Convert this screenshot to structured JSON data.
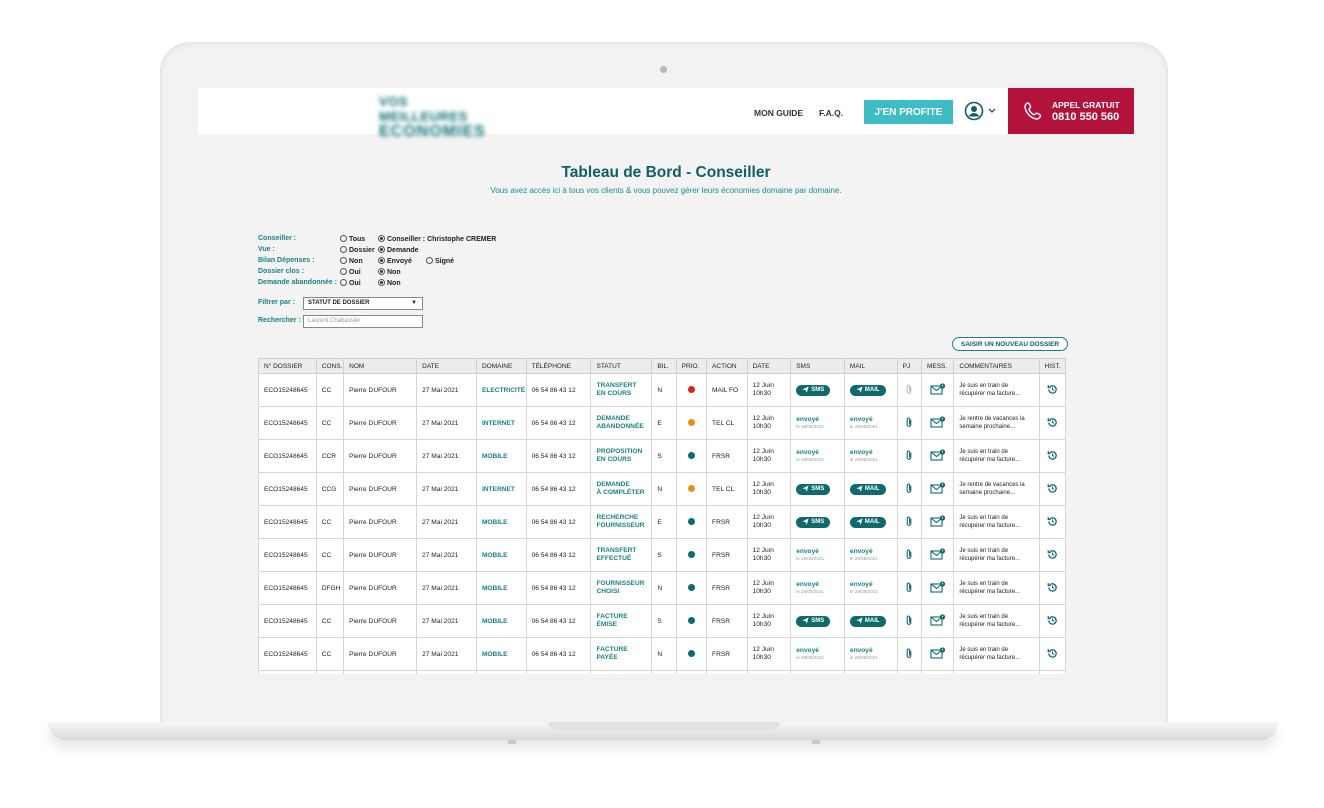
{
  "header": {
    "logo_line1": "VOS MEILLEURES",
    "logo_line2": "ECONOMIES",
    "nav": [
      "MON GUIDE",
      "F.A.Q."
    ],
    "cta_label": "J'EN PROFITE",
    "call_label": "APPEL GRATUIT",
    "call_number": "0810 550 560"
  },
  "page": {
    "title": "Tableau de Bord - Conseiller",
    "subtitle": "Vous avez accès ici à tous vos clients & vous pouvez gérer leurs économies domaine par domaine."
  },
  "filters": [
    {
      "label": "Conseiller :",
      "options": [
        {
          "text": "Tous",
          "selected": false
        },
        {
          "text": "Conseiller : Christophe CREMER",
          "selected": true
        }
      ]
    },
    {
      "label": "Vue :",
      "options": [
        {
          "text": "Dossier",
          "selected": false
        },
        {
          "text": "Demande",
          "selected": true
        }
      ]
    },
    {
      "label": "Bilan Dépenses :",
      "options": [
        {
          "text": "Non",
          "selected": false
        },
        {
          "text": "Envoyé",
          "selected": true
        },
        {
          "text": "Signé",
          "selected": false
        }
      ]
    },
    {
      "label": "Dossier clos :",
      "options": [
        {
          "text": "Oui",
          "selected": false
        },
        {
          "text": "Non",
          "selected": true
        }
      ]
    },
    {
      "label": "Demande abandonnée :",
      "options": [
        {
          "text": "Oui",
          "selected": false
        },
        {
          "text": "Non",
          "selected": true
        }
      ]
    }
  ],
  "filter_by": {
    "label": "Filtrer par :",
    "value": "STATUT DE DOSSIER"
  },
  "search": {
    "label": "Rechercher :",
    "placeholder": "Laurent Chabassier"
  },
  "new_button": "SAISIR UN NOUVEAU DOSSIER",
  "table": {
    "columns": [
      "N° DOSSIER",
      "CONS.",
      "NOM",
      "DATE",
      "DOMAINE",
      "TÉLÉPHONE",
      "STATUT",
      "BIL.",
      "PRIO.",
      "ACTION",
      "DATE",
      "SMS",
      "MAIL",
      "PJ",
      "MESS.",
      "COMMENTAIRES",
      "HIST."
    ],
    "sms_label": "SMS",
    "mail_label": "MAIL",
    "sent_label": "envoyé",
    "rows": [
      {
        "num": "ECO15248645",
        "cons": "CC",
        "nom": "Pierre DUFOUR",
        "date": "27 Mai 2021",
        "domaine": "ELECTRICITÉ",
        "tel": "06 54 86 43 12",
        "statut": [
          "TRANSFERT",
          "EN COURS"
        ],
        "bil": "N",
        "prio": "#e0201c",
        "action": "MAIL FO",
        "date2": [
          "12 Juin",
          "10h30"
        ],
        "sms": {
          "type": "button"
        },
        "mail": {
          "type": "button"
        },
        "pj": "inactive",
        "comment": [
          "Je suis en train de",
          "récupérer ma facture..."
        ]
      },
      {
        "num": "ECO15248645",
        "cons": "CC",
        "nom": "Pierre DUFOUR",
        "date": "27 Mai 2021",
        "domaine": "INTERNET",
        "tel": "06 54 86 43 12",
        "statut": [
          "DEMANDE",
          "ABANDONNÉE"
        ],
        "bil": "E",
        "prio": "#e8901a",
        "action": "TEL CL",
        "date2": [
          "12 Juin",
          "10h30"
        ],
        "sms": {
          "type": "sent",
          "date": "le 28/05/2021"
        },
        "mail": {
          "type": "sent",
          "date": "le 28/05/2021"
        },
        "pj": "active",
        "comment": [
          "Je rentre de vacances la",
          "semaine prochaine..."
        ]
      },
      {
        "num": "ECO15248645",
        "cons": "CCR",
        "nom": "Pierre DUFOUR",
        "date": "27 Mai 2021",
        "domaine": "MOBILE",
        "tel": "06 54 86 43 12",
        "statut": [
          "PROPOSITION",
          "EN COURS"
        ],
        "bil": "S",
        "prio": "#0f6a6e",
        "action": "FRSR",
        "date2": [
          "12 Juin",
          "10h30"
        ],
        "sms": {
          "type": "sent",
          "date": "le 28/05/2021"
        },
        "mail": {
          "type": "sent",
          "date": "le 28/05/2021"
        },
        "pj": "active",
        "comment": [
          "Je suis en train de",
          "récupérer ma facture..."
        ]
      },
      {
        "num": "ECO15248645",
        "cons": "CCG",
        "nom": "Pierre DUFOUR",
        "date": "27 Mai 2021",
        "domaine": "INTERNET",
        "tel": "06 54 86 43 12",
        "statut": [
          "DEMANDE",
          "À COMPLÉTER"
        ],
        "bil": "N",
        "prio": "#e8901a",
        "action": "TEL CL",
        "date2": [
          "12 Juin",
          "10h30"
        ],
        "sms": {
          "type": "button"
        },
        "mail": {
          "type": "button"
        },
        "pj": "active",
        "comment": [
          "Je rentre de vacances la",
          "semaine prochaine..."
        ]
      },
      {
        "num": "ECO15248645",
        "cons": "CC",
        "nom": "Pierre DUFOUR",
        "date": "27 Mai 2021",
        "domaine": "MOBILE",
        "tel": "06 54 86 43 12",
        "statut": [
          "RECHERCHE",
          "FOURNISSEUR"
        ],
        "bil": "E",
        "prio": "#0f6a6e",
        "action": "FRSR",
        "date2": [
          "12 Juin",
          "10h30"
        ],
        "sms": {
          "type": "button"
        },
        "mail": {
          "type": "button"
        },
        "pj": "active",
        "comment": [
          "Je suis en train de",
          "récupérer ma facture..."
        ]
      },
      {
        "num": "ECO15248645",
        "cons": "CC",
        "nom": "Pierre DUFOUR",
        "date": "27 Mai 2021",
        "domaine": "MOBILE",
        "tel": "06 54 86 43 12",
        "statut": [
          "TRANSFERT",
          "EFFECTUÉ"
        ],
        "bil": "S",
        "prio": "#0f6a6e",
        "action": "FRSR",
        "date2": [
          "12 Juin",
          "10h30"
        ],
        "sms": {
          "type": "sent",
          "date": "le 28/05/2021"
        },
        "mail": {
          "type": "sent",
          "date": "le 28/05/2021"
        },
        "pj": "active",
        "comment": [
          "Je suis en train de",
          "récupérer ma facture..."
        ]
      },
      {
        "num": "ECO15248645",
        "cons": "DFGH",
        "nom": "Pierre DUFOUR",
        "date": "27 Mai 2021",
        "domaine": "MOBILE",
        "tel": "06 54 86 43 12",
        "statut": [
          "FOURNISSEUR",
          "CHOISI"
        ],
        "bil": "N",
        "prio": "#0f6a6e",
        "action": "FRSR",
        "date2": [
          "12 Juin",
          "10h30"
        ],
        "sms": {
          "type": "sent",
          "date": "le 28/05/2021"
        },
        "mail": {
          "type": "sent",
          "date": "le 28/05/2021"
        },
        "pj": "active",
        "comment": [
          "Je suis en train de",
          "récupérer ma facture..."
        ]
      },
      {
        "num": "ECO15248645",
        "cons": "CC",
        "nom": "Pierre DUFOUR",
        "date": "27 Mai 2021",
        "domaine": "MOBILE",
        "tel": "06 54 86 43 12",
        "statut": [
          "FACTURE",
          "ÉMISE"
        ],
        "bil": "S",
        "prio": "#0f6a6e",
        "action": "FRSR",
        "date2": [
          "12 Juin",
          "10h30"
        ],
        "sms": {
          "type": "button"
        },
        "mail": {
          "type": "button"
        },
        "pj": "active",
        "comment": [
          "Je suis en train de",
          "récupérer ma facture..."
        ]
      },
      {
        "num": "ECO15248645",
        "cons": "CC",
        "nom": "Pierre DUFOUR",
        "date": "27 Mai 2021",
        "domaine": "MOBILE",
        "tel": "06 54 86 43 12",
        "statut": [
          "FACTURE",
          "PAYÉE"
        ],
        "bil": "N",
        "prio": "#0f6a6e",
        "action": "FRSR",
        "date2": [
          "12 Juin",
          "10h30"
        ],
        "sms": {
          "type": "sent",
          "date": "le 28/05/2021"
        },
        "mail": {
          "type": "sent",
          "date": "le 28/05/2021"
        },
        "pj": "active",
        "comment": [
          "Je suis en train de",
          "récupérer ma facture..."
        ]
      }
    ]
  },
  "icons": {
    "user": "user-circle-icon",
    "phone": "phone-icon",
    "sms_send": "send-icon",
    "attachment": "paperclip-icon",
    "message": "envelope-icon",
    "history": "history-icon"
  }
}
